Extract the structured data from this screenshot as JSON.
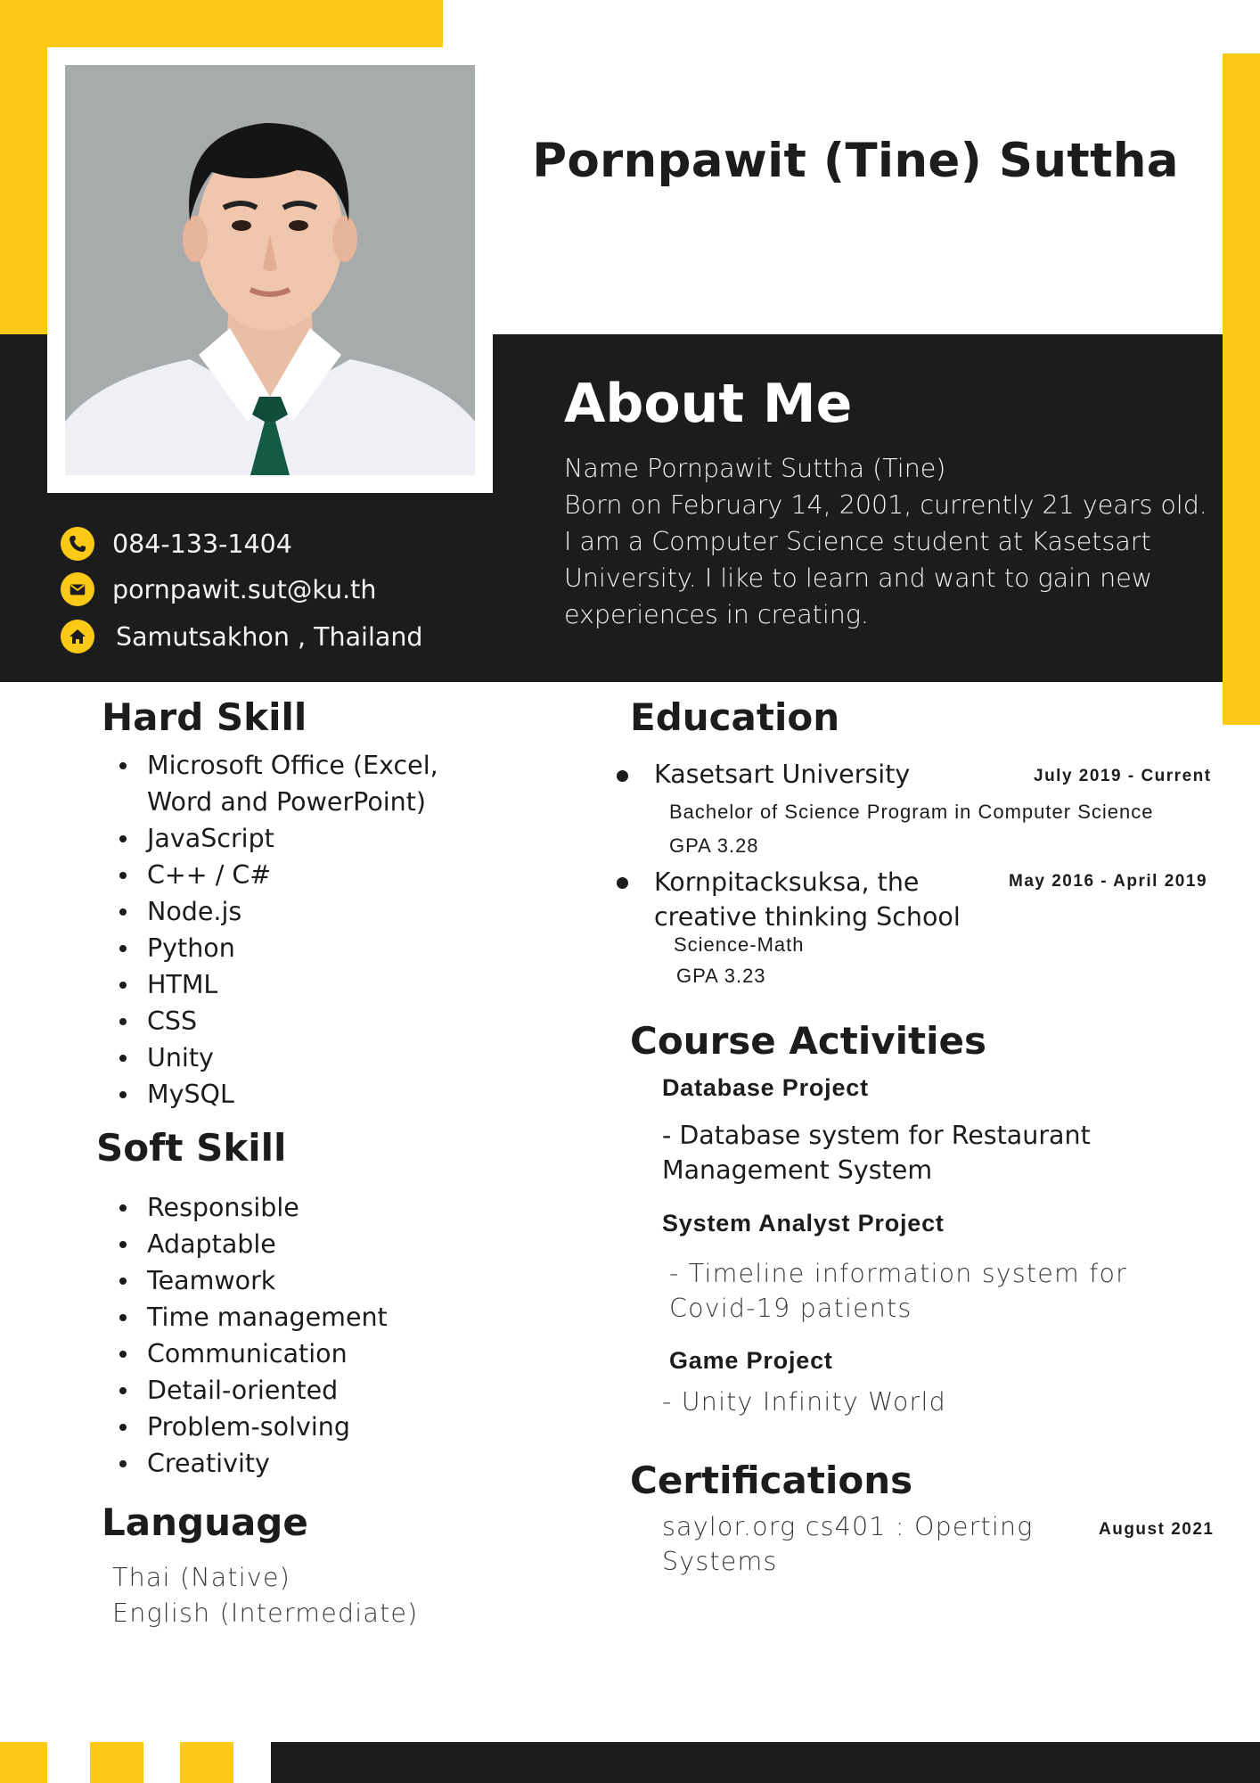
{
  "header": {
    "name": "Pornpawit (Tine) Suttha"
  },
  "about": {
    "title": "About Me",
    "lines": [
      "Name Pornpawit Suttha (Tine)",
      "Born on February 14, 2001, currently 21 years old.",
      "I am a Computer Science student at Kasetsart",
      "University. I like to learn and want to gain new",
      "experiences in creating."
    ]
  },
  "contact": {
    "phone": "084-133-1404",
    "email": "pornpawit.sut@ku.th",
    "location": "Samutsakhon , Thailand",
    "icons": [
      "phone-icon",
      "mail-icon",
      "home-icon"
    ]
  },
  "hard_skill": {
    "title": "Hard Skill",
    "items": [
      "Microsoft Office (Excel,",
      "Word and PowerPoint)",
      "JavaScript",
      "C++ / C#",
      "Node.js",
      "Python",
      "HTML",
      "CSS",
      "Unity",
      "MySQL"
    ]
  },
  "soft_skill": {
    "title": "Soft Skill",
    "items": [
      "Responsible",
      "Adaptable",
      "Teamwork",
      "Time management",
      "Communication",
      "Detail-oriented",
      "Problem-solving",
      "Creativity"
    ]
  },
  "language": {
    "title": "Language",
    "items": [
      "Thai (Native)",
      "English (Intermediate)"
    ]
  },
  "education": {
    "title": "Education",
    "entries": [
      {
        "school": "Kasetsart University",
        "date": "July 2019 - Current",
        "program": "Bachelor of Science Program in Computer Science",
        "gpa": "GPA 3.28"
      },
      {
        "school_line1": "Kornpitacksuksa, the",
        "school_line2": "creative thinking School",
        "date": "May 2016 - April 2019",
        "program": "Science-Math",
        "gpa": "GPA 3.23"
      }
    ]
  },
  "activities": {
    "title": "Course Activities",
    "projects": [
      {
        "title": "Database Project",
        "line1": "- Database system for Restaurant",
        "line2": "Management System"
      },
      {
        "title": "System Analyst Project",
        "line1": "- Timeline information system for",
        "line2": "Covid-19 patients"
      },
      {
        "title": "Game Project",
        "line1": "- Unity Infinity World"
      }
    ]
  },
  "certifications": {
    "title": "Certifications",
    "line1": "saylor.org cs401 : Operting",
    "line2": "Systems",
    "date": "August 2021"
  },
  "colors": {
    "accent": "#fcc917",
    "dark": "#1c1c1e"
  }
}
